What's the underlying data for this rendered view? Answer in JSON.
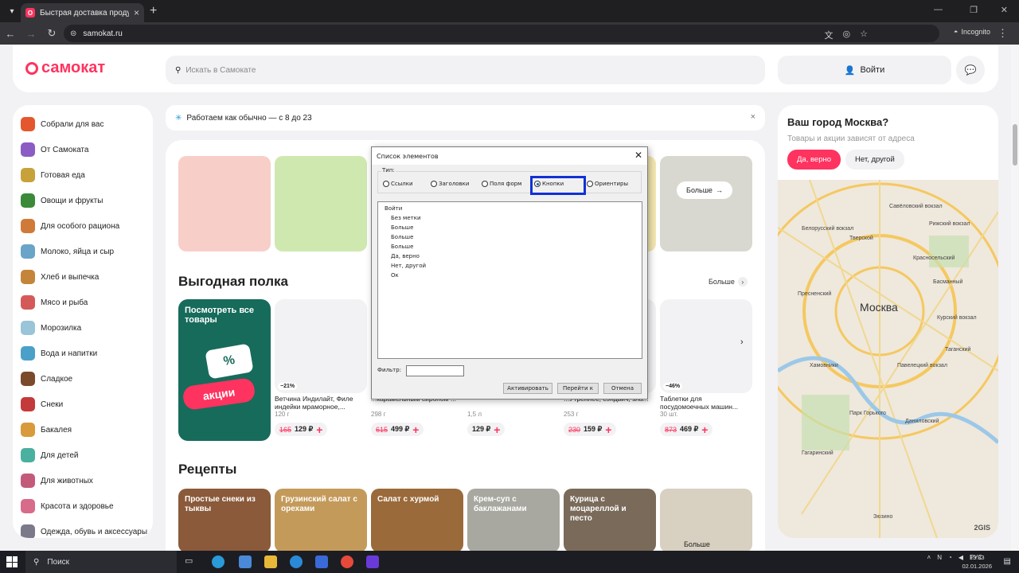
{
  "browser": {
    "tab_title": "Быстрая доставка продуктов",
    "url": "samokat.ru",
    "incognito_label": "Incognito"
  },
  "header": {
    "logo": "самокат",
    "search_placeholder": "Искать в Самокате",
    "login_label": "Войти"
  },
  "sidebar": {
    "items": [
      {
        "label": "Собрали для вас",
        "color": "#e4572e"
      },
      {
        "label": "От Самоката",
        "color": "#8a5cc4"
      },
      {
        "label": "Готовая еда",
        "color": "#c7a23a"
      },
      {
        "label": "Овощи и фрукты",
        "color": "#3a8a3a"
      },
      {
        "label": "Для особого рациона",
        "color": "#d07a3a"
      },
      {
        "label": "Молоко, яйца и сыр",
        "color": "#6aa4c8"
      },
      {
        "label": "Хлеб и выпечка",
        "color": "#c4843a"
      },
      {
        "label": "Мясо и рыба",
        "color": "#d45a5a"
      },
      {
        "label": "Морозилка",
        "color": "#9ac4d8"
      },
      {
        "label": "Вода и напитки",
        "color": "#4aa0c8"
      },
      {
        "label": "Сладкое",
        "color": "#7a4a2a"
      },
      {
        "label": "Снеки",
        "color": "#c43a3a"
      },
      {
        "label": "Бакалея",
        "color": "#d89a3a"
      },
      {
        "label": "Для детей",
        "color": "#4ab0a0"
      },
      {
        "label": "Для животных",
        "color": "#c45a7a"
      },
      {
        "label": "Красота и здоровье",
        "color": "#d86a8a"
      },
      {
        "label": "Одежда, обувь и аксессуары",
        "color": "#7a7a8a"
      }
    ]
  },
  "notice": {
    "text": "Работаем как обычно — с 8 до 23"
  },
  "banners": {
    "more_label": "Больше"
  },
  "deals": {
    "title": "Выгодная полка",
    "more_label": "Больше",
    "promo_text": "Посмотреть все товары",
    "promo_pct": "%",
    "promo_word": "акции",
    "products": [
      {
        "name": "Ветчина Индилайт, Филе индейки мраморное,...",
        "weight": "120 г",
        "old": "165",
        "price": "129 ₽",
        "discount": "−21%"
      },
      {
        "name": "...карамельным сиропом ...",
        "weight": "298 г",
        "old": "615",
        "price": "499 ₽",
        "discount": ""
      },
      {
        "name": "",
        "weight": "1,5 л",
        "old": "",
        "price": "129 ₽",
        "discount": ""
      },
      {
        "name": "...Утреннее, сэндвич, зла...",
        "weight": "253 г",
        "old": "230",
        "price": "159 ₽",
        "discount": ""
      },
      {
        "name": "Таблетки для посудомоечных машин...",
        "weight": "30 шт.",
        "old": "873",
        "price": "469 ₽",
        "discount": "−46%"
      }
    ]
  },
  "recipes": {
    "title": "Рецепты",
    "items": [
      {
        "label": "Простые снеки из тыквы",
        "color": "#8a5a3a"
      },
      {
        "label": "Грузинский салат с орехами",
        "color": "#c49a5a"
      },
      {
        "label": "Салат с хурмой",
        "color": "#9a6a3a"
      },
      {
        "label": "Крем-суп с баклажанами",
        "color": "#a8a8a0"
      },
      {
        "label": "Курица с моцареллой и песто",
        "color": "#7a6a5a"
      },
      {
        "label": "Больше",
        "color": "#d8d0c0"
      }
    ]
  },
  "city": {
    "title": "Ваш город Москва?",
    "subtitle": "Товары и акции зависят от адреса",
    "yes_label": "Да, верно",
    "no_label": "Нет, другой"
  },
  "map": {
    "city_label": "Москва",
    "labels": [
      "Савёловский вокзал",
      "Рижский вокзал",
      "Белорусский вокзал",
      "Тверской",
      "Красносельский",
      "Басманный",
      "Курский вокзал",
      "Павелецкий вокзал",
      "Таганский",
      "Даниловский",
      "Парк Горького",
      "Гагаринский",
      "Пресненский",
      "Хамовники",
      "Зюзино"
    ],
    "brand": "2GIS"
  },
  "dialog": {
    "title": "Список элементов",
    "type_label": "Тип:",
    "radios": [
      "Ссылки",
      "Заголовки",
      "Поля форм",
      "Кнопки",
      "Ориентиры"
    ],
    "selected": "Кнопки",
    "list_root": "Войти",
    "list_children": [
      "Без метки",
      "Больше",
      "Больше",
      "Больше",
      "Да, верно",
      "Нет, другой",
      "Ок"
    ],
    "filter_label": "Фильтр:",
    "filter_value": "",
    "btn_activate": "Активировать",
    "btn_goto": "Перейти к",
    "btn_cancel": "Отмена"
  },
  "taskbar": {
    "search_label": "Поиск",
    "lang": "РУС",
    "time": "13:33",
    "date": "02.01.2026"
  }
}
